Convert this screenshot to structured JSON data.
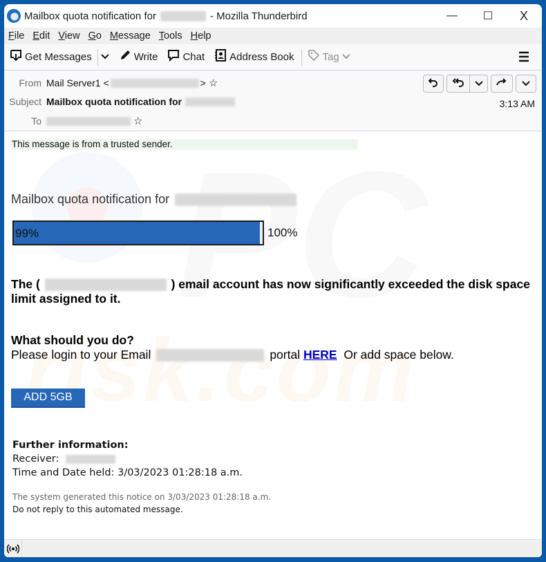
{
  "window": {
    "title_prefix": "Mailbox quota notification for",
    "title_suffix": "- Mozilla Thunderbird",
    "controls": {
      "minimize": "—",
      "maximize": "☐",
      "close": "X"
    }
  },
  "menubar": {
    "items": [
      {
        "key": "F",
        "rest": "ile"
      },
      {
        "key": "E",
        "rest": "dit"
      },
      {
        "key": "V",
        "rest": "iew"
      },
      {
        "key": "G",
        "rest": "o"
      },
      {
        "key": "M",
        "rest": "essage"
      },
      {
        "key": "T",
        "rest": "ools"
      },
      {
        "key": "H",
        "rest": "elp"
      }
    ]
  },
  "toolbar": {
    "get_messages": "Get Messages",
    "write": "Write",
    "chat": "Chat",
    "address_book": "Address Book",
    "tag": "Tag"
  },
  "header": {
    "from_label": "From",
    "from_name": "Mail Server1",
    "from_open": "<",
    "from_close": ">",
    "subject_label": "Subject",
    "subject": "Mailbox quota notification for",
    "to_label": "To",
    "time": "3:13 AM"
  },
  "body": {
    "trusted_notice": "This message is from a trusted sender.",
    "headline": "Mailbox quota notification for",
    "progress": {
      "value_percent": 99,
      "label": "99%",
      "max_label": "100%"
    },
    "warning_pre": "The (",
    "warning_post": ") email account has now significantly exceeded the disk space limit assigned to it.",
    "question": "What should you do?",
    "instruction_pre": "Please login to your Email",
    "instruction_mid": "portal",
    "link_text": "HERE",
    "instruction_post": "Or add space below.",
    "add_button": "ADD 5GB",
    "further_title": "Further information:",
    "receiver_label": "Receiver:",
    "time_held": "Time and Date held: 3/03/2023 01:28:18 a.m.",
    "system_notice": "The system generated this notice on 3/03/2023 01:28:18 a.m.",
    "no_reply": "Do not reply to this automated message."
  },
  "watermark": {
    "text": "risk.com",
    "logo": "PC"
  }
}
